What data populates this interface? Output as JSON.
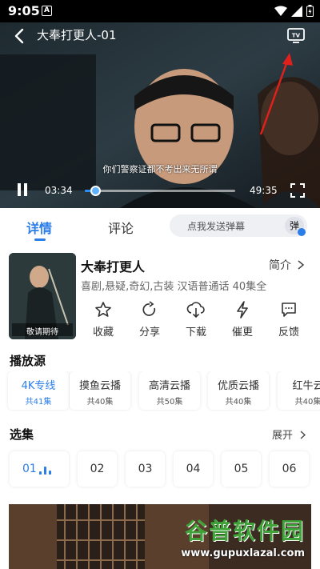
{
  "status_bar": {
    "time": "9:05",
    "notification_icon": "A"
  },
  "player": {
    "title": "大奉打更人-01",
    "subtitle": "你们警察证都不考出来无所谓",
    "current_time": "03:34",
    "total_time": "49:35",
    "progress": 0.07
  },
  "tabs": [
    {
      "label": "详情"
    },
    {
      "label": "评论"
    }
  ],
  "danmu": {
    "placeholder": "点我发送弹幕",
    "badge": "弹"
  },
  "show": {
    "title": "大奉打更人",
    "intro_label": "简介",
    "meta": "喜剧,悬疑,奇幻,古装 汉语普通话 40集全",
    "poster_caption": "敬请期待"
  },
  "actions": [
    {
      "label": "收藏",
      "icon": "star-icon"
    },
    {
      "label": "分享",
      "icon": "share-icon"
    },
    {
      "label": "下载",
      "icon": "download-icon"
    },
    {
      "label": "催更",
      "icon": "lightning-icon"
    },
    {
      "label": "反馈",
      "icon": "feedback-icon"
    }
  ],
  "sources_title": "播放源",
  "sources": [
    {
      "name": "4K专线",
      "count": "共41集"
    },
    {
      "name": "摸鱼云播",
      "count": "共40集"
    },
    {
      "name": "高清云播",
      "count": "共50集"
    },
    {
      "name": "优质云播",
      "count": "共40集"
    },
    {
      "name": "红牛云",
      "count": "共40集"
    }
  ],
  "episodes_title": "选集",
  "expand_label": "展开",
  "episodes": [
    "01",
    "02",
    "03",
    "04",
    "05",
    "06"
  ],
  "watermark": {
    "text": "谷普软件园",
    "url": "www.gupuxlazal.com"
  },
  "colors": {
    "accent": "#2b7de9",
    "annotation_arrow": "#e0201c"
  }
}
